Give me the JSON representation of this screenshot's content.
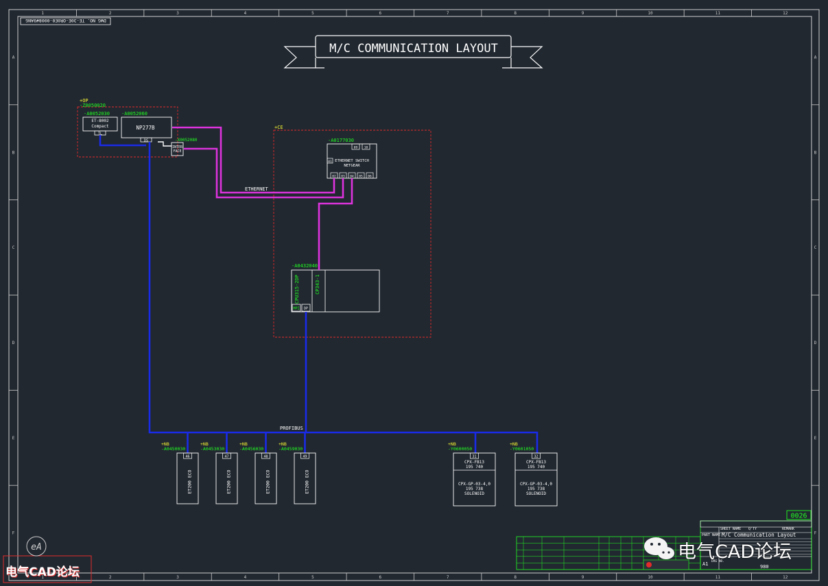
{
  "colors": {
    "background": "#212830",
    "line": "#ffffff",
    "label": "#22ff22",
    "plus_label": "#f4f433",
    "ethernet": "#dd33dd",
    "profibus": "#1a2be8",
    "enclosure": "#e22b2b"
  },
  "drawing_no": "DWG NO. TE-30E-OR0E0-0008#9ANG",
  "title": "M/C COMMUNICATION LAYOUT",
  "zone_numbers": [
    "1",
    "2",
    "3",
    "4",
    "5",
    "6",
    "7",
    "8",
    "9",
    "10",
    "11",
    "12"
  ],
  "zone_letters": [
    "A",
    "B",
    "C",
    "D",
    "E",
    "F"
  ],
  "op_panel": {
    "location": "+OP",
    "panel_id": "-Z0050020",
    "et_id": "-A0052030",
    "et_line1": "ET-8002",
    "et_line2": "Compact",
    "et_port": "TL",
    "hmi_id": "-A0052060",
    "hmi_label": "NP277B",
    "hmi_port": "DS",
    "iface_id": "-X0052080",
    "iface_line1": "INTER",
    "iface_line2": "FACE"
  },
  "ce_cabinet": {
    "location": "+CE",
    "switch_id": "-A0177030",
    "switch_line1": "ETHERNET SWITCH",
    "switch_line2": "NETGEAR",
    "switch_left_port": "01",
    "switch_top_ports": [
      "09",
      "10"
    ],
    "switch_bottom_ports": [
      "02",
      "03",
      "04",
      "05",
      "06"
    ],
    "cpu_id": "-A0432040",
    "cpu_label1": "CPU315-2DP",
    "cpu_label2": "CP343-1",
    "cpu_port1": "MPI",
    "cpu_port2": "DP"
  },
  "ethernet_label": "ETHERNET",
  "profibus_label": "PROFIBUS",
  "et200_nodes": [
    {
      "location": "+NB",
      "id": "-A0450030",
      "address": "46",
      "name": "ET200 ECO"
    },
    {
      "location": "+NB",
      "id": "-A0453030",
      "address": "47",
      "name": "ET200 ECO"
    },
    {
      "location": "+NB",
      "id": "-A0456030",
      "address": "48",
      "name": "ET200 ECO"
    },
    {
      "location": "+NB",
      "id": "-A0459030",
      "address": "49",
      "name": "ET200 ECO"
    }
  ],
  "valve_nodes": [
    {
      "location": "+NB",
      "id": "-Y0600050",
      "address": "31",
      "line1": "CPX-FB13",
      "line2": "195 740",
      "line3": "CPX-GP-03-4,0",
      "line4": "195 738",
      "line5": "SOLENOID"
    },
    {
      "location": "+NB",
      "id": "-Y0601050",
      "address": "32",
      "line1": "CPX-FB13",
      "line2": "195 740",
      "line3": "CPX-GP-03-4,0",
      "line4": "195 738",
      "line5": "SOLENOID"
    }
  ],
  "title_block": {
    "sheet_no": "0026",
    "name_header": "SHEET NAME",
    "qty_header": "Q'TY",
    "remark_header": "REMARK",
    "part_name_label": "PART NAME",
    "part_name": "M/C Communication Layout",
    "size": "A1",
    "drawing_label": "DRG NO.",
    "code": "980"
  },
  "watermark": {
    "text_right": "电气CAD论坛",
    "text_left": "电气CAD论坛",
    "logo_letters": "eA"
  }
}
